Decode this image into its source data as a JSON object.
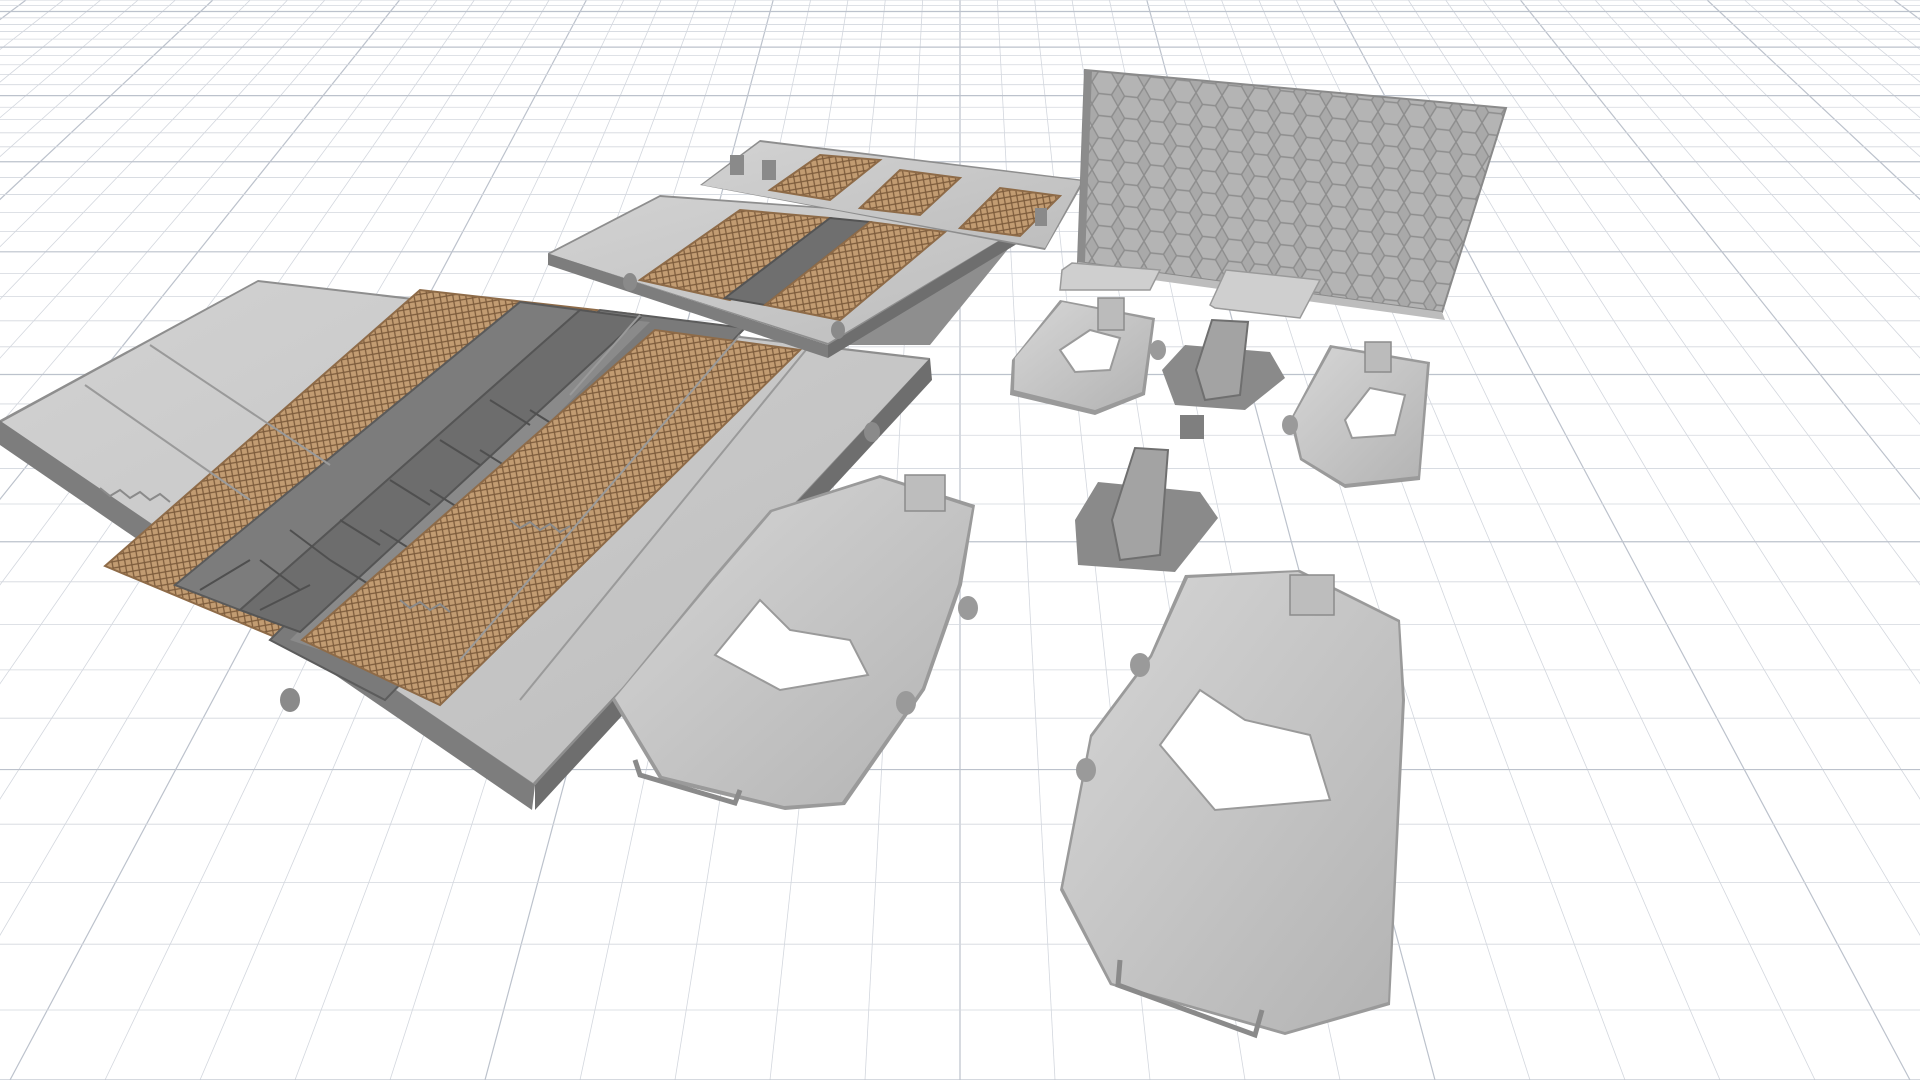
{
  "viewport": {
    "background": "#ffffff",
    "grid_line_color": "#d3d7de",
    "grid_major_color": "#bcc2cc"
  },
  "scene": {
    "part_colors": {
      "plate_top": "#c9c9c9",
      "plate_side": "#8e8e8e",
      "grate": "#b8916a",
      "grate_mesh": "#7a5a3a",
      "rail": "#6f6f6f",
      "hex_panel": "#a6a6a6",
      "bracket": "#c4c4c4",
      "bracket_shadow": "#9a9a9a",
      "stand": "#8a8a8a"
    },
    "objects": [
      "floor-plate-large",
      "floor-plate-medium",
      "floor-plate-small",
      "hex-wall-panel",
      "small-tab-left",
      "small-tab-right",
      "bracket-small-left",
      "bracket-small-right",
      "stand-upper",
      "stand-lower",
      "bracket-large-left",
      "bracket-large-right"
    ]
  }
}
